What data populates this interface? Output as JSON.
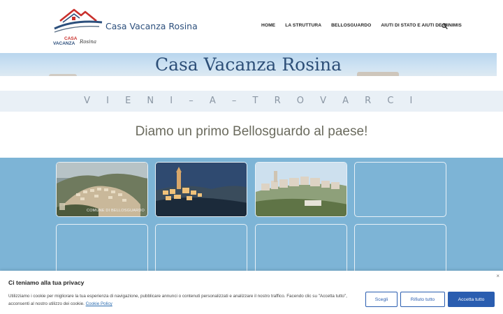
{
  "header": {
    "logo_text_top": "CASA",
    "logo_text_bottom": "VACANZA",
    "logo_script": "Rosina",
    "site_title": "Casa Vacanza Rosina",
    "nav": [
      "HOME",
      "LA STRUTTURA",
      "BELLOSGUARDO",
      "AIUTI DI STATO E AIUTI DE MINIMIS"
    ]
  },
  "banner": {
    "title": "Casa Vacanza Rosina"
  },
  "tagline": "V I E N I – A – T R O V A R C I",
  "heading": "Diamo un primo Bellosguardo al paese!",
  "gallery": {
    "tile1_caption": "COMUNE DI BELLOSGUARDO"
  },
  "cookie": {
    "title": "Ci teniamo alla tua privacy",
    "text": "Utilizziamo i cookie per migliorare la tua esperienza di navigazione, pubblicare annunci o contenuti personalizzati e analizzare il nostro traffico. Facendo clic su \"Accetta tutto\", acconsenti al nostro utilizzo dei cookie.",
    "link": "Cookie Policy",
    "buttons": {
      "choose": "Scegli",
      "reject": "Rifiuto tutto",
      "accept": "Accetta tutto"
    },
    "close": "×"
  },
  "colors": {
    "accent": "#2a5db0",
    "title_blue": "#2d4f78",
    "gallery_bg": "#7db4d6"
  }
}
